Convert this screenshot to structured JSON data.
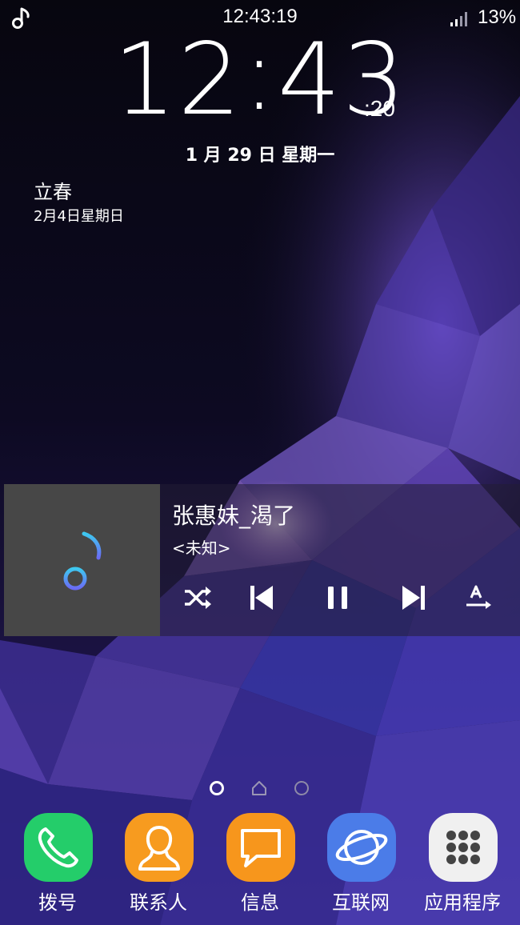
{
  "status_bar": {
    "time": "12:43:19",
    "battery": "13%",
    "notification_icon": "music-note-icon",
    "signal_icon": "signal-icon"
  },
  "lock_clock": {
    "hours": "12",
    "minutes": "43",
    "seconds": ":20",
    "date": "1 月 29 日 星期一"
  },
  "calendar_event": {
    "name": "立春",
    "date": "2月4日星期日"
  },
  "music_player": {
    "title": "张惠妹_渴了",
    "artist": "<未知>",
    "album_art_icon": "music-note-icon",
    "controls": [
      "shuffle-icon",
      "previous-icon",
      "pause-icon",
      "next-icon",
      "lyrics-icon"
    ]
  },
  "page_indicator": {
    "pages": [
      "page-dot",
      "home-page",
      "page-dot"
    ],
    "active_index": 0
  },
  "dock": {
    "apps": [
      {
        "label": "拨号",
        "icon": "phone-icon",
        "color": "#24cd6a"
      },
      {
        "label": "联系人",
        "icon": "contact-icon",
        "color": "#f79b1f"
      },
      {
        "label": "信息",
        "icon": "message-icon",
        "color": "#f7961c"
      },
      {
        "label": "互联网",
        "icon": "planet-icon",
        "color": "#4b7ce8"
      },
      {
        "label": "应用程序",
        "icon": "apps-grid-icon",
        "color": "#f0f0f0"
      }
    ]
  },
  "colors": {
    "wallpaper_dark": "#0c0a1e",
    "wallpaper_purple": "#5a3cb4",
    "widget_background": "#474747",
    "music_note_gradient": [
      "#3ec8f0",
      "#6a6cf5"
    ]
  }
}
